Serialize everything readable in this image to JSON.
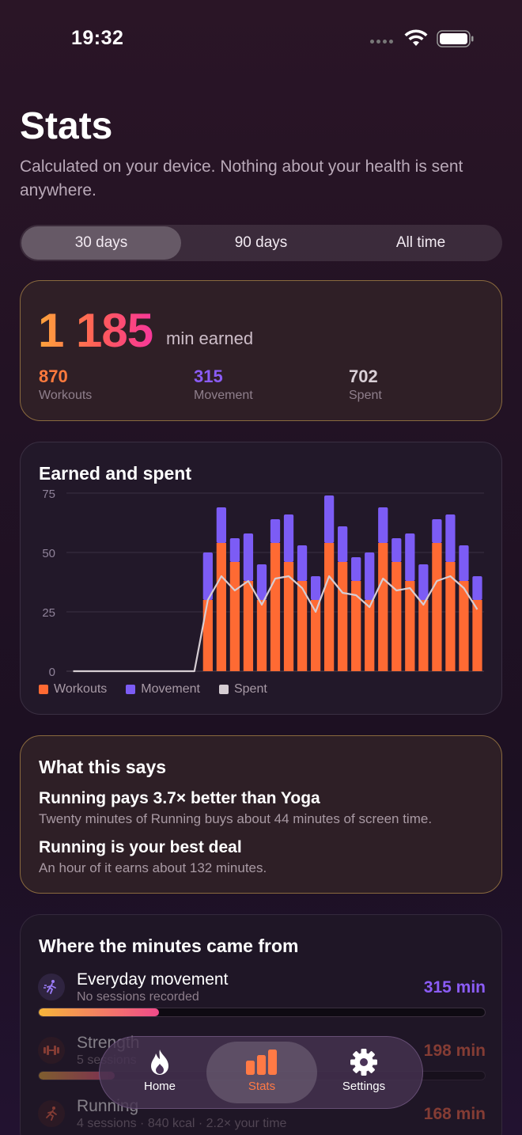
{
  "status_bar": {
    "time": "19:32"
  },
  "header": {
    "title": "Stats",
    "subtitle": "Calculated on your device. Nothing about your health is sent anywhere."
  },
  "range_tabs": [
    {
      "label": "30 days",
      "active": true
    },
    {
      "label": "90 days",
      "active": false
    },
    {
      "label": "All time",
      "active": false
    }
  ],
  "summary": {
    "total": "1 185",
    "unit": "min earned",
    "stats": [
      {
        "value": "870",
        "label": "Workouts",
        "color": "#ff7a3d"
      },
      {
        "value": "315",
        "label": "Movement",
        "color": "#8b5cf6"
      },
      {
        "value": "702",
        "label": "Spent",
        "color": "#d9cfd6"
      }
    ]
  },
  "chart_card": {
    "title": "Earned and spent",
    "legend": [
      {
        "label": "Workouts",
        "color": "#ff6a33"
      },
      {
        "label": "Movement",
        "color": "#7c5cf5"
      },
      {
        "label": "Spent",
        "color": "#d6cdd3"
      }
    ]
  },
  "chart_data": {
    "type": "bar",
    "stacked": true,
    "ylim": [
      0,
      75
    ],
    "yticks": [
      "75",
      "50",
      "25",
      "0"
    ],
    "yticks_values": [
      75,
      50,
      25,
      0
    ],
    "grid": true,
    "legend_position": "bottom-left",
    "series": [
      {
        "name": "Workouts",
        "color": "#ff6a33",
        "values": [
          0,
          0,
          0,
          0,
          0,
          0,
          0,
          0,
          0,
          0,
          30,
          54,
          46,
          38,
          30,
          54,
          46,
          38,
          30,
          54,
          46,
          38,
          30,
          54,
          46,
          38,
          30,
          54,
          46,
          38,
          30
        ]
      },
      {
        "name": "Movement",
        "color": "#7c5cf5",
        "values": [
          0,
          0,
          0,
          0,
          0,
          0,
          0,
          0,
          0,
          0,
          20,
          15,
          10,
          20,
          15,
          10,
          20,
          15,
          10,
          20,
          15,
          10,
          20,
          15,
          10,
          20,
          15,
          10,
          20,
          15,
          10
        ]
      },
      {
        "name": "Spent",
        "color": "#d6cdd3",
        "type": "line",
        "values": [
          0,
          0,
          0,
          0,
          0,
          0,
          0,
          0,
          0,
          0,
          30,
          40,
          34,
          38,
          28,
          39,
          40,
          35,
          25,
          40,
          33,
          32,
          27,
          39,
          34,
          35,
          28,
          38,
          40,
          35,
          26
        ]
      }
    ]
  },
  "insights": {
    "title": "What this says",
    "items": [
      {
        "heading": "Running pays 3.7× better than Yoga",
        "detail": "Twenty minutes of Running buys about 44 minutes of screen time."
      },
      {
        "heading": "Running is your best deal",
        "detail": "An hour of it earns about 132 minutes."
      }
    ]
  },
  "sources": {
    "title": "Where the minutes came from",
    "items": [
      {
        "name": "Everyday movement",
        "detail": "No sessions recorded",
        "value": "315 min",
        "color": "#8b5cf6",
        "icon": "walking-icon",
        "fraction": 0.27
      },
      {
        "name": "Strength",
        "detail": "5 sessions",
        "value": "198 min",
        "color": "#ff6a45",
        "icon": "dumbbell-icon",
        "fraction": 0.17
      },
      {
        "name": "Running",
        "detail": "4 sessions · 840 kcal · 2.2× your time",
        "value": "168 min",
        "color": "#ff6a45",
        "icon": "running-icon",
        "fraction": 0.14
      }
    ]
  },
  "tabbar": [
    {
      "label": "Home",
      "icon": "flame-icon",
      "active": false
    },
    {
      "label": "Stats",
      "icon": "bar-chart-icon",
      "active": true
    },
    {
      "label": "Settings",
      "icon": "gear-icon",
      "active": false
    }
  ]
}
